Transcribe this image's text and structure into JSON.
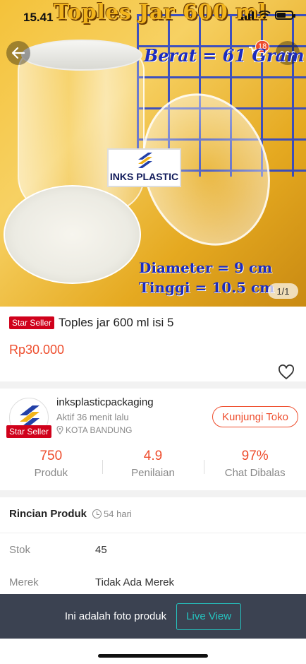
{
  "status_bar": {
    "time": "15.41"
  },
  "hero": {
    "title": "Toples Jar 600 ml",
    "weight_text": "Berat = 61 Gram",
    "brand_text": "INKS PLASTIC",
    "diameter_text": "Diameter = 9 cm",
    "height_text": "Tinggi = 10.5 cm",
    "pager": "1/1",
    "cart_count": "18"
  },
  "product": {
    "badge": "Star Seller",
    "title": "Toples jar 600 ml isi 5",
    "price": "Rp30.000"
  },
  "shop": {
    "badge": "Star Seller",
    "name": "inksplasticpackaging",
    "active": "Aktif 36 menit lalu",
    "location": "KOTA BANDUNG",
    "visit_label": "Kunjungi Toko",
    "stats": [
      {
        "value": "750",
        "label": "Produk"
      },
      {
        "value": "4.9",
        "label": "Penilaian"
      },
      {
        "value": "97%",
        "label": "Chat Dibalas"
      }
    ]
  },
  "details": {
    "title": "Rincian Produk",
    "age": "54 hari",
    "rows": [
      {
        "key": "Stok",
        "value": "45"
      },
      {
        "key": "Merek",
        "value": "Tidak Ada Merek"
      }
    ]
  },
  "bottom_bar": {
    "text": "Ini adalah foto produk",
    "button": "Live View"
  },
  "colors": {
    "accent": "#ee4d2d",
    "badge": "#d0011b",
    "live": "#25c4c0",
    "bar": "#3b4251"
  }
}
